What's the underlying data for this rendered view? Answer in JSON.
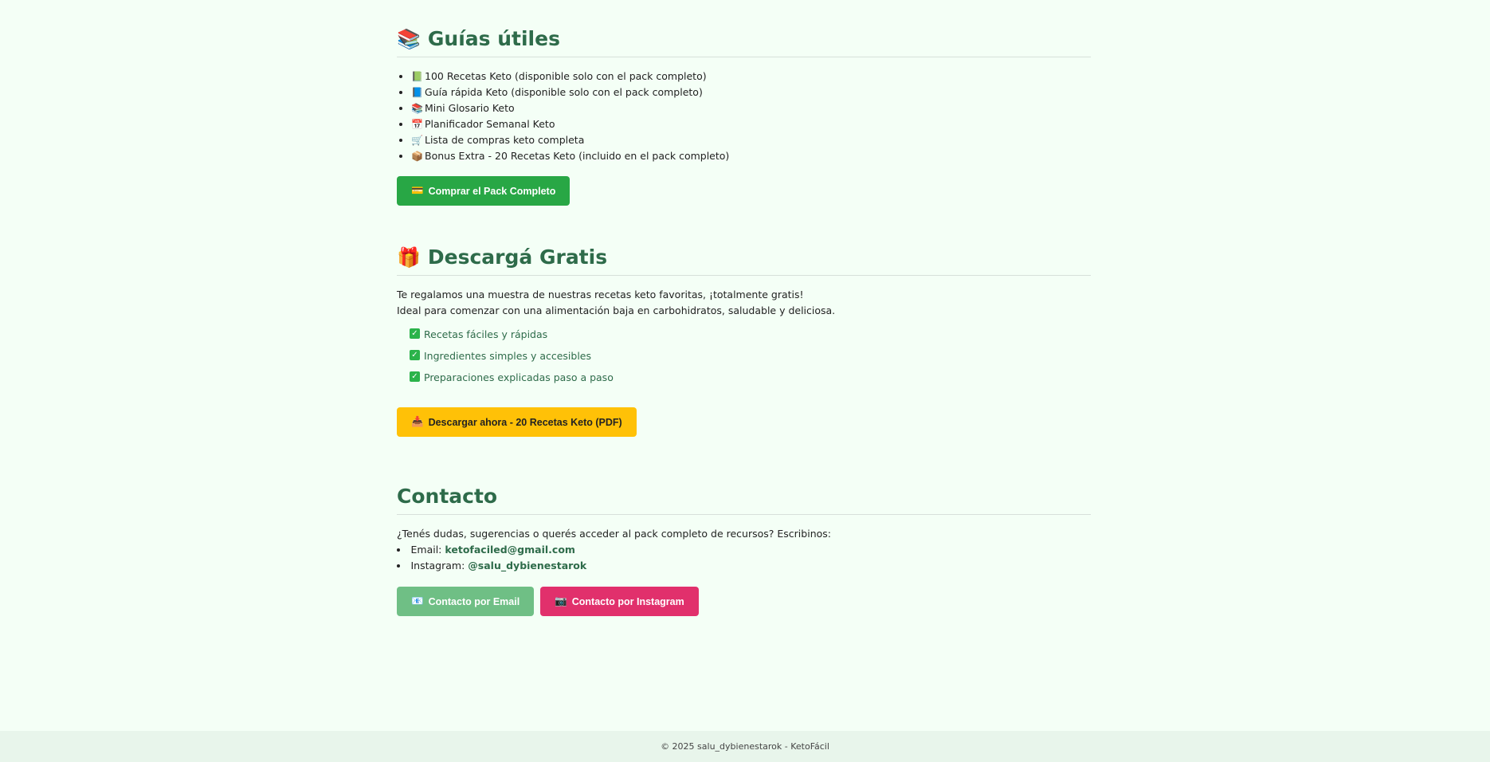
{
  "guides": {
    "heading": "Guías útiles",
    "heading_icon": "books-icon",
    "items": [
      {
        "icon": "📗",
        "text": "100 Recetas Keto (disponible solo con el pack completo)"
      },
      {
        "icon": "📘",
        "text": "Guía rápida Keto (disponible solo con el pack completo)"
      },
      {
        "icon": "📚",
        "text": "Mini Glosario Keto"
      },
      {
        "icon": "📅",
        "text": "Planificador Semanal Keto"
      },
      {
        "icon": "🛒",
        "text": "Lista de compras keto completa"
      },
      {
        "icon": "📦",
        "text": "Bonus Extra - 20 Recetas Keto (incluido en el pack completo)"
      }
    ],
    "buy_button": {
      "icon": "💳",
      "label": "Comprar el Pack Completo",
      "color": "#28a745"
    }
  },
  "free": {
    "heading": "Descargá Gratis",
    "heading_icon": "gift-icon",
    "intro_line1": "Te regalamos una muestra de nuestras recetas keto favoritas, ¡totalmente gratis!",
    "intro_line2": "Ideal para comenzar con una alimentación baja en carbohidratos, saludable y deliciosa.",
    "checks": [
      "Recetas fáciles y rápidas",
      "Ingredientes simples y accesibles",
      "Preparaciones explicadas paso a paso"
    ],
    "download_button": {
      "icon": "📥",
      "label": "Descargar ahora - 20 Recetas Keto (PDF)",
      "color": "#ffc107"
    }
  },
  "contact": {
    "heading": "Contacto",
    "intro": "¿Tenés dudas, sugerencias o querés acceder al pack completo de recursos? Escribinos:",
    "email_label": "Email:",
    "email": "ketofaciled@gmail.com",
    "instagram_label": "Instagram:",
    "instagram": "@salu_dybienestarok",
    "email_button": {
      "icon": "📧",
      "label": "Contacto por Email",
      "color": "#6fbf85"
    },
    "instagram_button": {
      "icon": "📷",
      "label": "Contacto por Instagram",
      "color": "#e1306c"
    }
  },
  "footer": {
    "text": "© 2025 salu_dybienestarok - KetoFácil"
  },
  "colors": {
    "heading": "#2e6b4a",
    "background": "#f4fff6",
    "footer_bg": "#e8f5eb"
  }
}
